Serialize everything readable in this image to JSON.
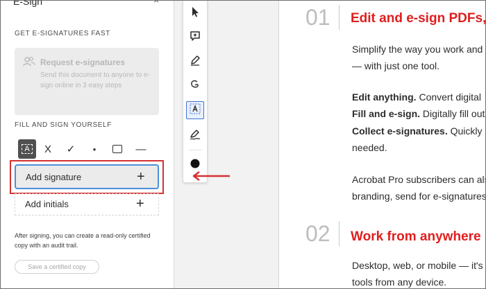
{
  "panel": {
    "title": "E-Sign",
    "close": "×",
    "get_fast_label": "GET E-SIGNATURES FAST",
    "request": {
      "title": "Request e-signatures",
      "description": "Send this document to anyone to e-sign online in 3 easy steps"
    },
    "fill_sign_label": "FILL AND SIGN YOURSELF",
    "tools": {
      "text": "A",
      "cross": "X",
      "check": "✓",
      "dot": "●",
      "rect": "",
      "line": "—"
    },
    "add_signature": "Add signature",
    "add_initials": "Add initials",
    "plus": "+",
    "after_note": "After signing, you can create a read-only certified copy with an audit trail.",
    "certified_button": "Save a certified copy"
  },
  "colors": {
    "accent_blue": "#4a8fd8",
    "highlight_red": "#d43131",
    "doc_title_red": "#e01e1e"
  },
  "doc": {
    "sections": [
      {
        "number": "01",
        "title": "Edit and e-sign PDFs,",
        "paragraphs": [
          {
            "line1": "Simplify the way you work and",
            "line2": "— with just one tool."
          },
          {
            "bold1": "Edit anything.",
            "rest1": " Convert digital",
            "bold2": "Fill and e-sign.",
            "rest2": " Digitally fill out",
            "bold3": "Collect e-signatures.",
            "rest3": " Quickly g",
            "line4": "needed."
          },
          {
            "line1": "Acrobat Pro subscribers can als",
            "line2": "branding, send for e-signatures"
          }
        ]
      },
      {
        "number": "02",
        "title": "Work from anywhere",
        "paragraphs": [
          {
            "line1": "Desktop, web, or mobile — it's",
            "line2": "tools from any device."
          }
        ]
      }
    ]
  },
  "toolbar": {
    "icons": [
      "cursor-icon",
      "add-comment-icon",
      "pen-icon",
      "lasso-icon",
      "text-field-icon",
      "sign-icon",
      "color-dot-icon"
    ]
  }
}
